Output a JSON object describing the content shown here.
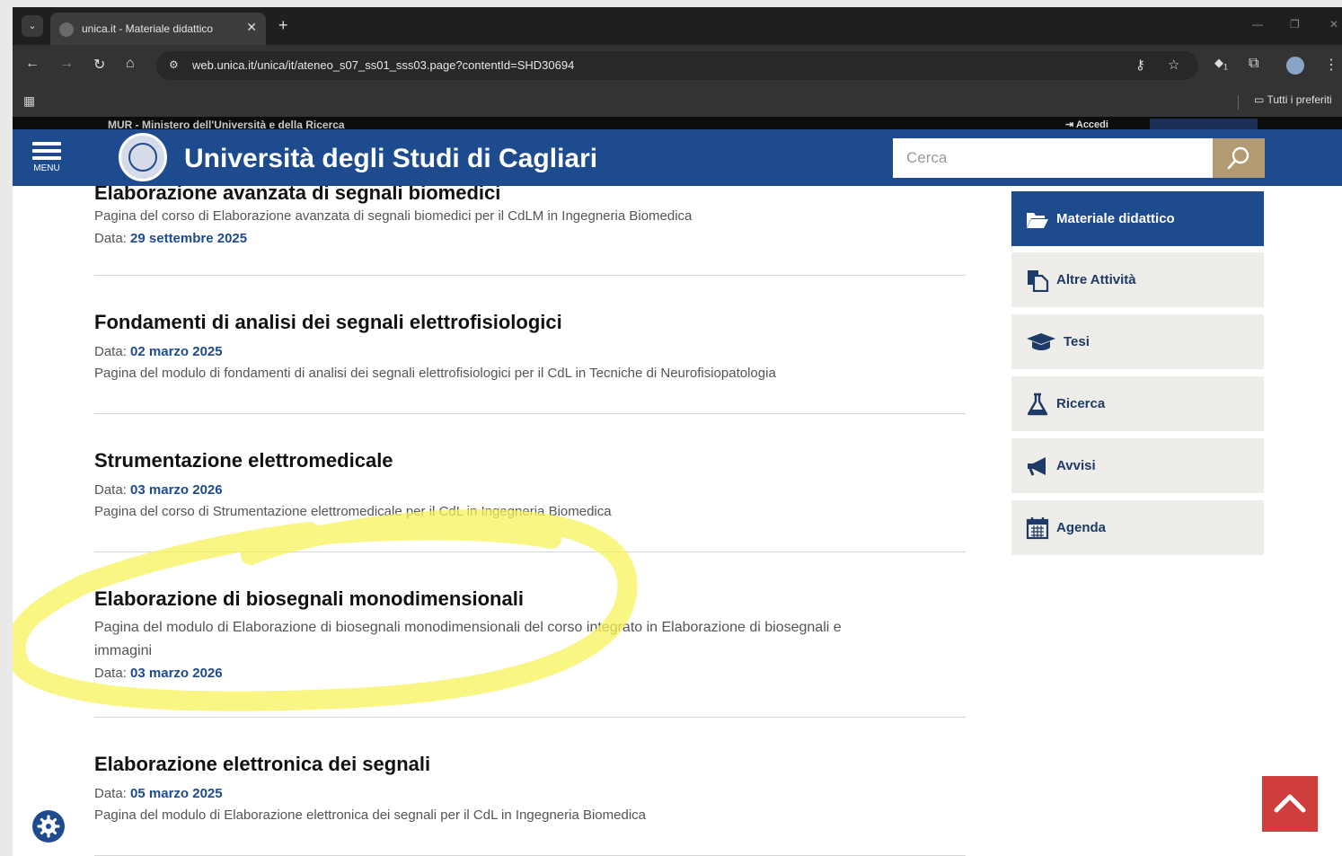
{
  "browser": {
    "tab_title": "unica.it - Materiale didattico",
    "url": "web.unica.it/unica/it/ateneo_s07_ss01_sss03.page?contentId=SHD30694",
    "bookmark_folder": "Tutti i preferiti",
    "extension_badge": "1"
  },
  "topstrip": {
    "ministry_text": "MUR - Ministero dell'Università e della Ricerca",
    "login_label": "Accedi"
  },
  "header": {
    "menu_label": "MENU",
    "site_title": "Università degli Studi di Cagliari",
    "search_placeholder": "Cerca"
  },
  "content": {
    "cut_title": "Elaborazione avanzata di segnali biomedici",
    "date_prefix": "Data:",
    "articles": [
      {
        "description": "Pagina del corso di Elaborazione avanzata di segnali biomedici per il CdLM in Ingegneria Biomedica",
        "date": "29 settembre 2025"
      },
      {
        "title": "Fondamenti di analisi dei segnali elettrofisiologici",
        "date": "02 marzo 2025",
        "description": "Pagina del modulo di fondamenti di analisi dei segnali elettrofisiologici per il CdL in Tecniche di Neurofisiopatologia"
      },
      {
        "title": "Strumentazione elettromedicale",
        "date": "03 marzo 2026",
        "description": "Pagina del corso di Strumentazione elettromedicale per il CdL in Ingegneria Biomedica"
      },
      {
        "title": "Elaborazione di biosegnali monodimensionali",
        "description_line1": "Pagina del modulo di Elaborazione di biosegnali monodimensionali del corso integrato in Elaborazione di biosegnali e",
        "description_line2": "immagini",
        "date": "03 marzo 2026"
      },
      {
        "title": "Elaborazione elettronica dei segnali",
        "date": "05 marzo 2025",
        "description": "Pagina del modulo di Elaborazione elettronica dei segnali per il CdL in Ingegneria Biomedica"
      }
    ]
  },
  "sidebar": {
    "items": [
      {
        "label": "Materiale didattico",
        "icon": "folder-open-icon",
        "active": true
      },
      {
        "label": "Altre Attività",
        "icon": "documents-icon"
      },
      {
        "label": "Tesi",
        "icon": "graduation-cap-icon"
      },
      {
        "label": "Ricerca",
        "icon": "flask-icon"
      },
      {
        "label": "Avvisi",
        "icon": "megaphone-icon"
      },
      {
        "label": "Agenda",
        "icon": "calendar-icon"
      }
    ]
  },
  "colors": {
    "brand_blue": "#1e4b8e",
    "search_gold": "#b29a73",
    "scroll_top_red": "#d03d3d",
    "highlight_yellow": "#f7f35a"
  }
}
